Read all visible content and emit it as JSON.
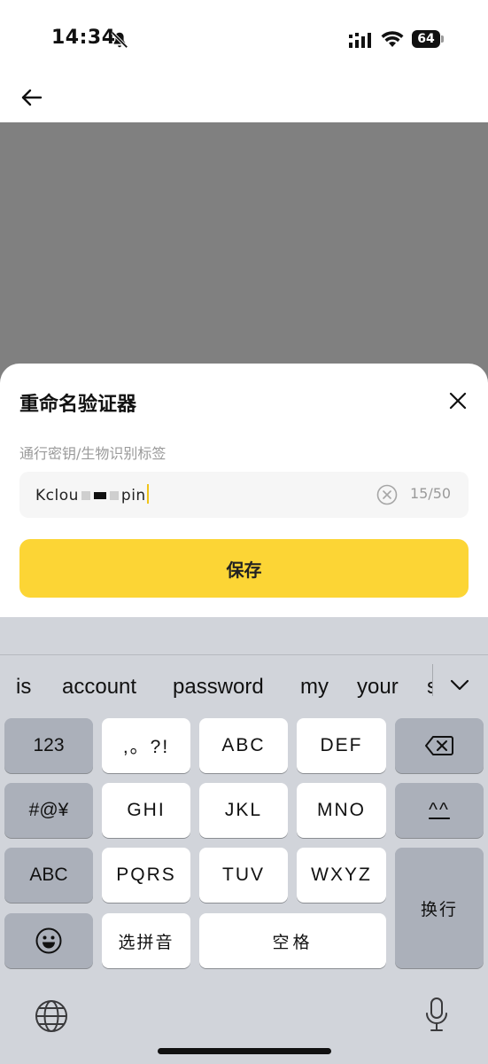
{
  "status_bar": {
    "time": "14:34",
    "battery": "64"
  },
  "sheet": {
    "title": "重命名验证器",
    "field_label": "通行密钥/生物识别标签",
    "input_value_visible": "Kclou",
    "input_value_tail": "pin",
    "counter": "15/50",
    "save_label": "保存"
  },
  "keyboard": {
    "suggestions": [
      "is",
      "account",
      "password",
      "my",
      "your",
      "s"
    ],
    "rows": {
      "num_label": "123",
      "punct_label": ",。?!",
      "abc_label": "ABC",
      "def_label": "DEF",
      "symbols_label": "#@¥",
      "ghi_label": "GHI",
      "jkl_label": "JKL",
      "mno_label": "MNO",
      "emoticon_label": "^^",
      "abc_switch_label": "ABC",
      "pqrs_label": "PQRS",
      "tuv_label": "TUV",
      "wxyz_label": "WXYZ",
      "return_label": "换行",
      "pinyin_label": "选拼音",
      "space_label": "空格"
    }
  },
  "colors": {
    "accent": "#fcd535",
    "overlay": "#808080",
    "keyboard_bg": "#d1d4da",
    "key_dark": "#abb0ba"
  },
  "icons": [
    "bell-slash-icon",
    "signal-icon",
    "wifi-icon",
    "battery-icon",
    "back-arrow-icon",
    "close-icon",
    "clear-icon",
    "backspace-icon",
    "emoji-icon",
    "globe-icon",
    "mic-icon",
    "chevron-down-icon"
  ]
}
